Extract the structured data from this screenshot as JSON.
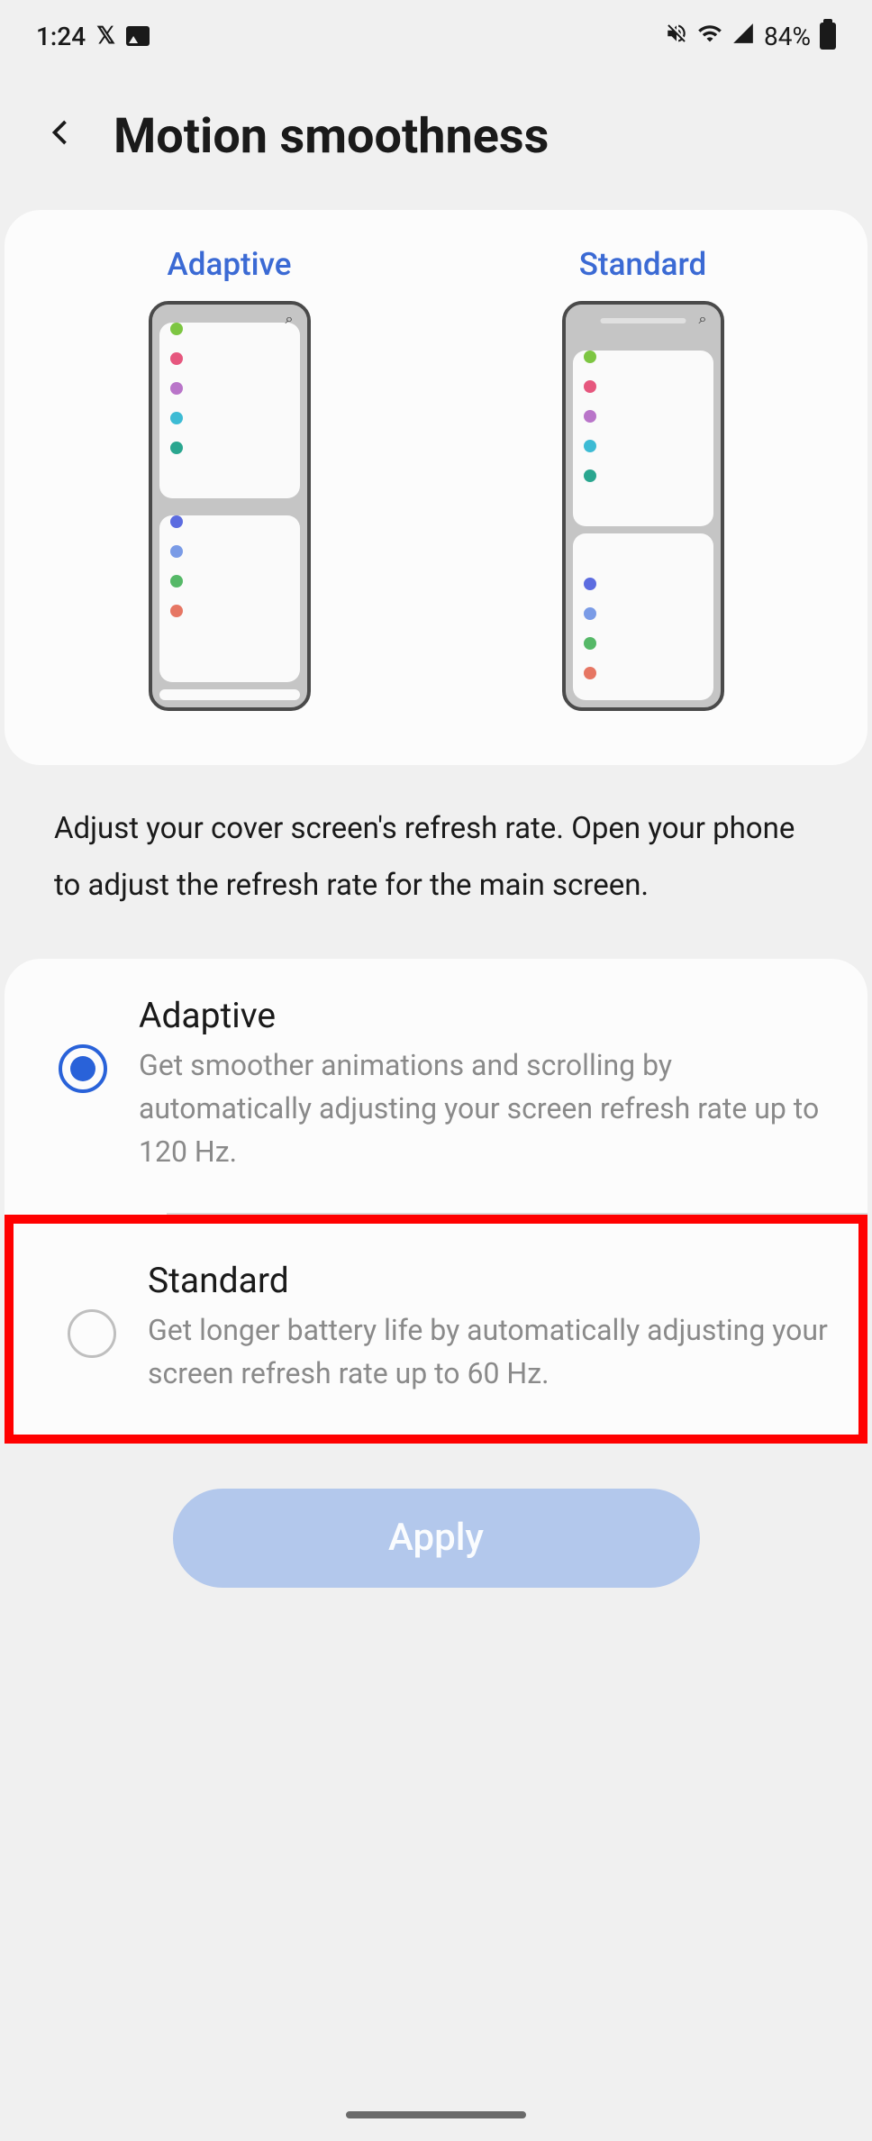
{
  "status": {
    "time": "1:24",
    "battery": "84%"
  },
  "header": {
    "title": "Motion smoothness"
  },
  "preview": {
    "adaptive_label": "Adaptive",
    "standard_label": "Standard"
  },
  "description": "Adjust your cover screen's refresh rate. Open your phone to adjust the refresh rate for the main screen.",
  "options": {
    "adaptive": {
      "title": "Adaptive",
      "desc": "Get smoother animations and scrolling by automatically adjusting your screen refresh rate up to 120 Hz.",
      "selected": true
    },
    "standard": {
      "title": "Standard",
      "desc": "Get longer battery life by automatically adjusting your screen refresh rate up to 60 Hz.",
      "selected": false,
      "highlighted": true
    }
  },
  "apply_button": "Apply"
}
